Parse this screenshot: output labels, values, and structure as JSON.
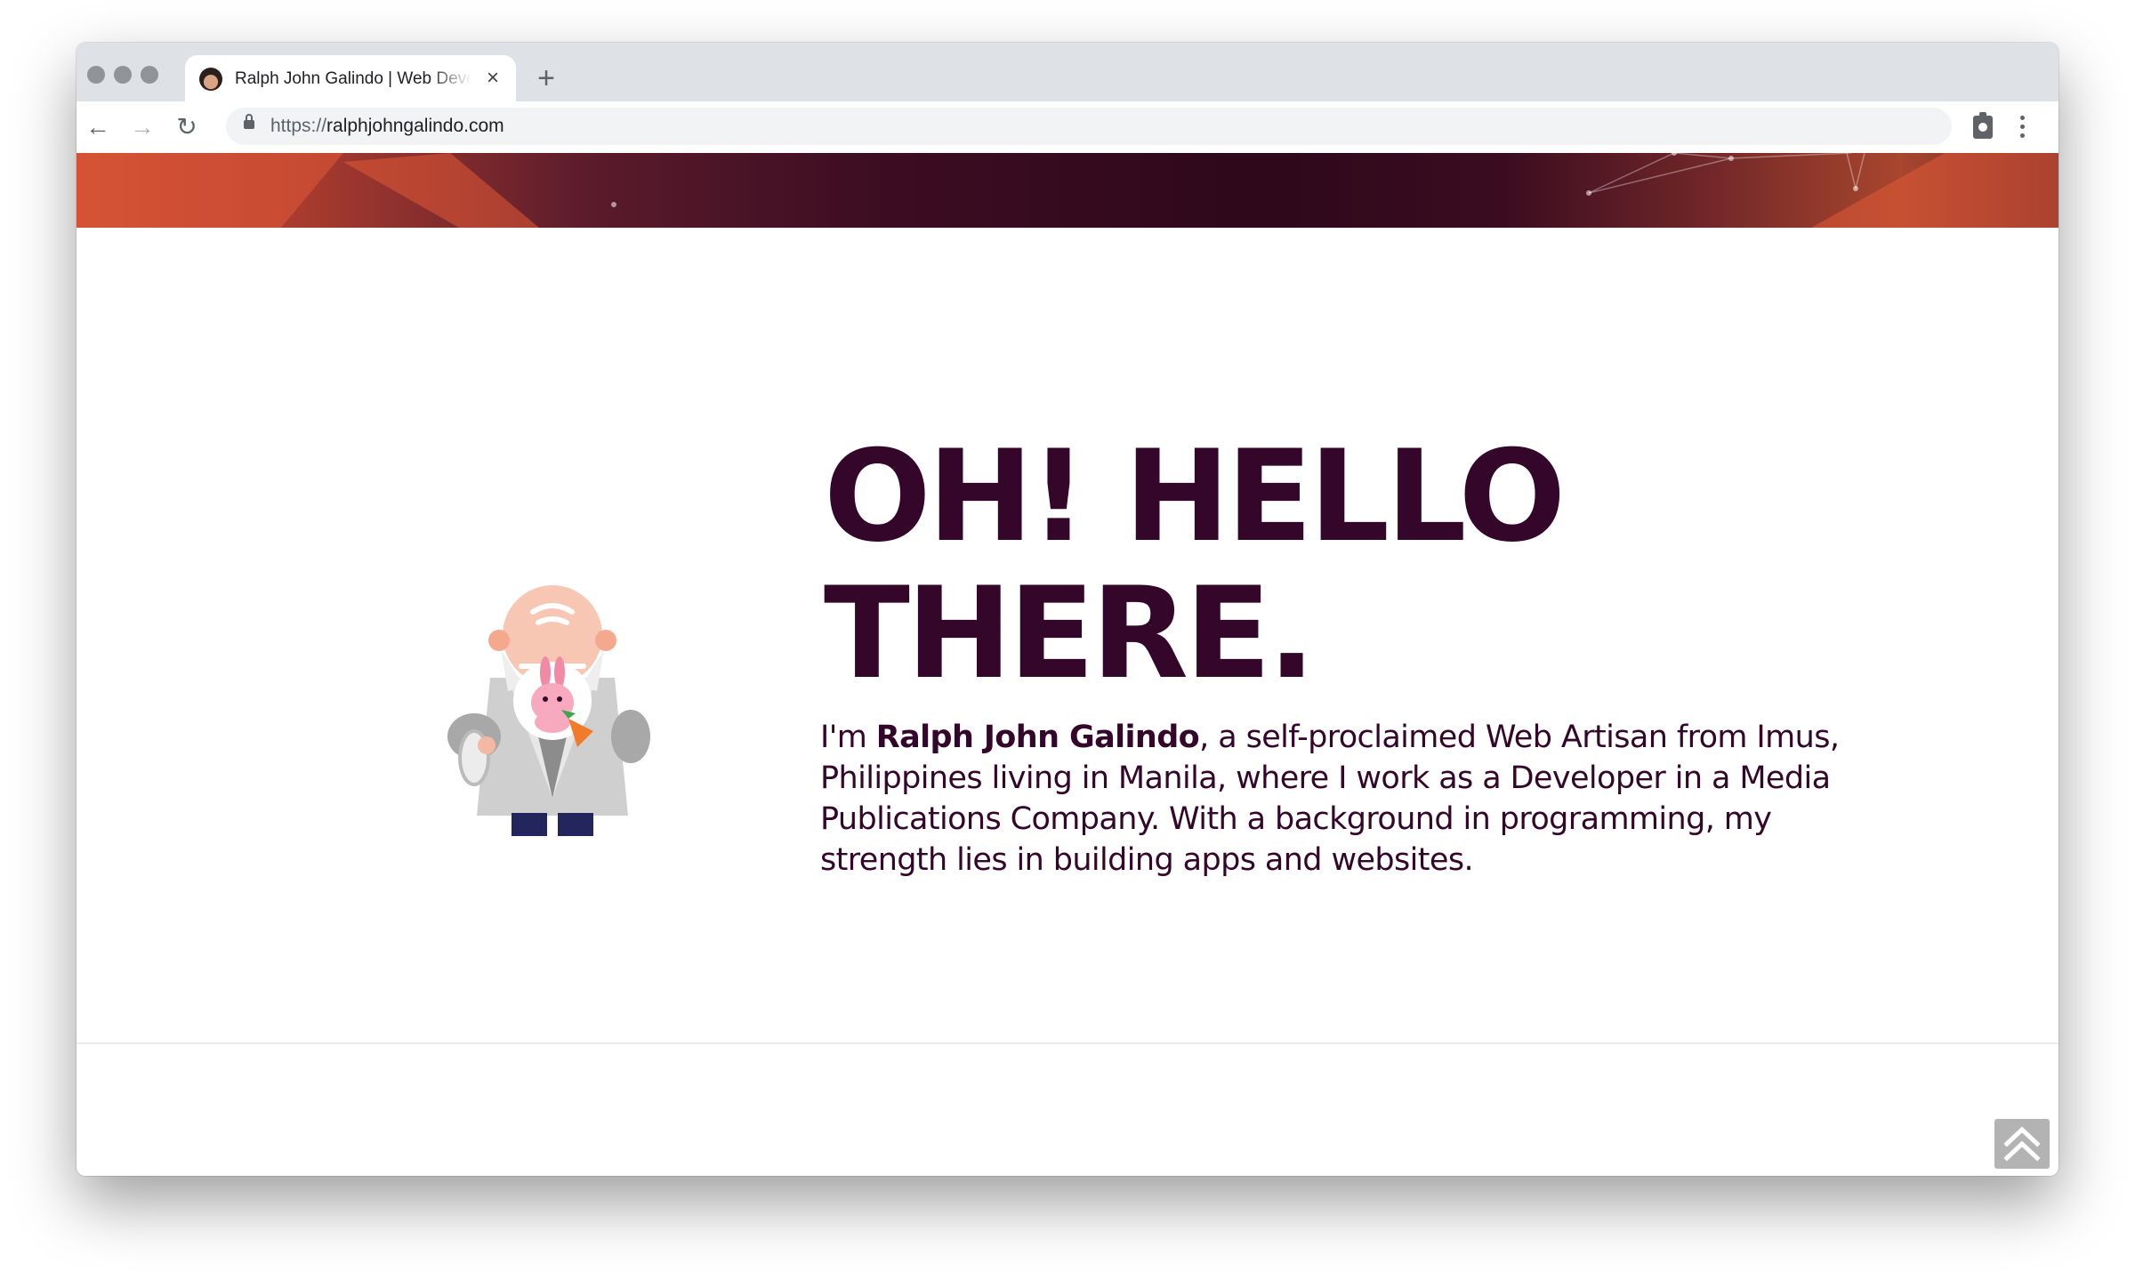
{
  "browser": {
    "tab": {
      "title": "Ralph John Galindo | Web Developer",
      "close_glyph": "×"
    },
    "new_tab_glyph": "+",
    "nav": {
      "back_glyph": "←",
      "forward_glyph": "→",
      "reload_glyph": "↻"
    },
    "url": {
      "scheme": "https://",
      "host": "ralphjohngalindo.com"
    },
    "icons": [
      "lock-icon",
      "clipboard-extension-icon",
      "kebab-menu-icon"
    ]
  },
  "hero": {
    "headline_line1": "OH! HELLO",
    "headline_line2": "THERE.",
    "intro_prefix": "I'm ",
    "intro_name": "Ralph John Galindo",
    "intro_rest": ", a self-proclaimed Web Artisan from Imus, Philippines living in Manila, where I work as a Developer in a Media Publications Company. With a background in programming, my strength lies in building apps and websites.",
    "illustration": "old-man-with-bunny-illustration"
  },
  "colors": {
    "headline": "#33062a",
    "banner_start": "#c64a34",
    "banner_mid": "#2f081b",
    "scroll_top_bg": "#b3b3b3"
  },
  "scroll_top": {
    "icon": "double-chevron-up-icon"
  }
}
